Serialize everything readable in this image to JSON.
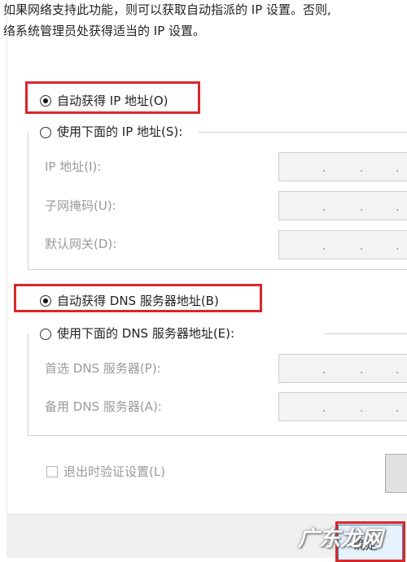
{
  "description": {
    "line1": "如果网络支持此功能，则可以获取自动指派的 IP 设置。否则,",
    "line2": "络系统管理员处获得适当的 IP 设置。"
  },
  "ip": {
    "auto_label": "自动获得 IP 地址(O)",
    "manual_label": "使用下面的 IP 地址(S):",
    "address_label": "IP 地址(I):",
    "subnet_label": "子网掩码(U):",
    "gateway_label": "默认网关(D):"
  },
  "dns": {
    "auto_label": "自动获得 DNS 服务器地址(B)",
    "manual_label": "使用下面的 DNS 服务器地址(E):",
    "preferred_label": "首选 DNS 服务器(P):",
    "alternate_label": "备用 DNS 服务器(A):"
  },
  "validate_label": "退出时验证设置(L)",
  "ok_button_label": "确定",
  "watermark": "广东龙网",
  "colors": {
    "highlight_red": "#d9262d",
    "disabled_text": "#9a9a9a"
  }
}
